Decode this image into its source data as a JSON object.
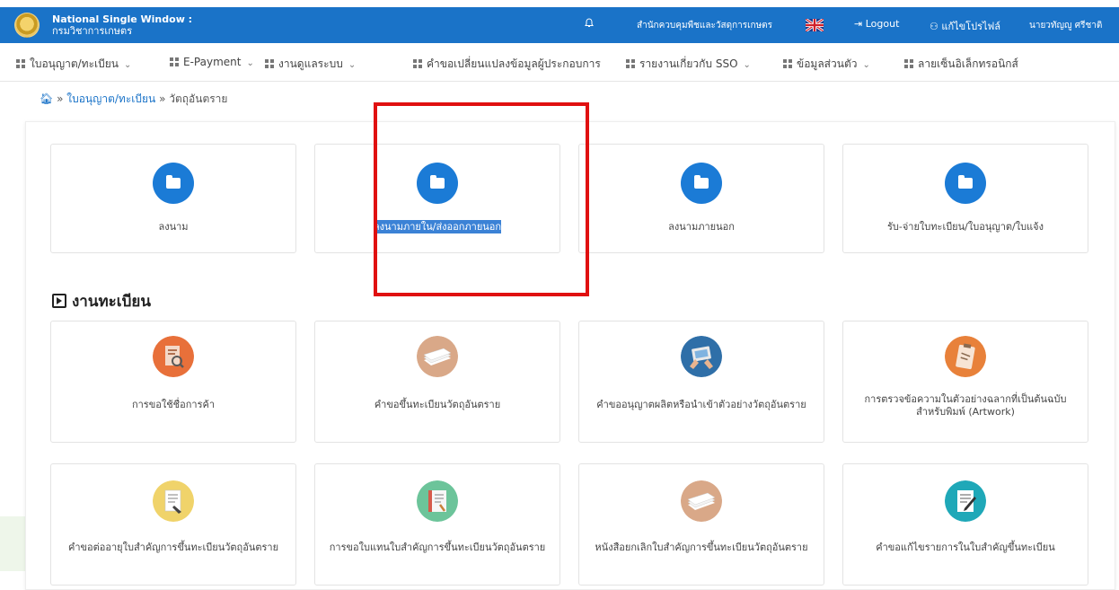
{
  "header": {
    "brand_line1": "National Single Window :",
    "brand_line2": "กรมวิชาการเกษตร",
    "department": "สำนักควบคุมพืชและวัสดุการเกษตร",
    "logout": "Logout",
    "profile": "แก้ไขโปรไฟล์",
    "user_name": "นายวทัญญู ศรีชาติ",
    "accent_color": "#1a73c8"
  },
  "menu": [
    {
      "label": "ใบอนุญาต/ทะเบียน",
      "dropdown": true
    },
    {
      "label": "E-Payment",
      "dropdown": true
    },
    {
      "label": "งานดูแลระบบ",
      "dropdown": true
    },
    {
      "label": "คำขอเปลี่ยนแปลงข้อมูลผู้ประกอบการ",
      "dropdown": false
    },
    {
      "label": "รายงานเกี่ยวกับ SSO",
      "dropdown": true
    },
    {
      "label": "ข้อมูลส่วนตัว",
      "dropdown": true
    },
    {
      "label": "ลายเซ็นอิเล็กทรอนิกส์",
      "dropdown": false
    }
  ],
  "breadcrumb": {
    "sep": "»",
    "link": "ใบอนุญาต/ทะเบียน",
    "current": "วัตถุอันตราย"
  },
  "top_cards": [
    {
      "label": "ลงนาม",
      "icon": "folder-icon"
    },
    {
      "label": "ลงนามภายใน/ส่งออกภายนอก",
      "icon": "folder-icon",
      "selected": true
    },
    {
      "label": "ลงนามภายนอก",
      "icon": "folder-icon"
    },
    {
      "label": "รับ-จ่ายใบทะเบียน/ใบอนุญาต/ใบแจ้ง",
      "icon": "folder-icon"
    }
  ],
  "section": {
    "title": "งานทะเบียน"
  },
  "reg_cards_row1": [
    {
      "label": "การขอใช้ชื่อการค้า",
      "icon": "document-search-icon",
      "color": "#e8703a"
    },
    {
      "label": "คำขอขึ้นทะเบียนวัตถุอันตราย",
      "icon": "paper-stack-icon",
      "color": "#d9a888"
    },
    {
      "label": "คำขออนุญาตผลิตหรือนำเข้าตัวอย่างวัตถุอันตราย",
      "icon": "tablet-hand-icon",
      "color": "#2f6fa8"
    },
    {
      "label": "การตรวจข้อความในตัวอย่างฉลากที่เป็นต้นฉบับสำหรับพิมพ์ (Artwork)",
      "icon": "clipboard-icon",
      "color": "#e8813a"
    }
  ],
  "reg_cards_row2": [
    {
      "label": "คำขอต่ออายุใบสำคัญการขึ้นทะเบียนวัตถุอันตราย",
      "icon": "document-icon",
      "color": "#f0d36a"
    },
    {
      "label": "การขอใบแทนใบสำคัญการขึ้นทะเบียนวัตถุอันตราย",
      "icon": "notebook-icon",
      "color": "#6cc49a"
    },
    {
      "label": "หนังสือยกเลิกใบสำคัญการขึ้นทะเบียนวัตถุอันตราย",
      "icon": "paper-stack-icon",
      "color": "#d9a888"
    },
    {
      "label": "คำขอแก้ไขรายการในใบสำคัญขึ้นทะเบียน",
      "icon": "edit-note-icon",
      "color": "#1fa8b8"
    }
  ]
}
